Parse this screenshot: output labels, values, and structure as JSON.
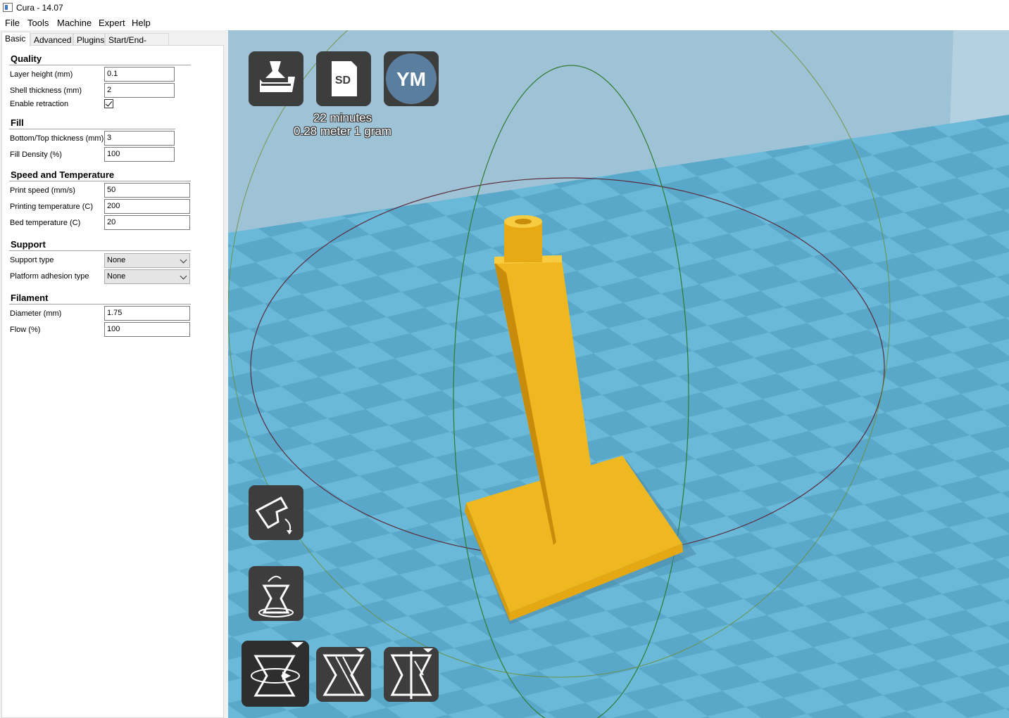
{
  "window": {
    "title": "Cura - 14.07"
  },
  "menu": [
    "File",
    "Tools",
    "Machine",
    "Expert",
    "Help"
  ],
  "tabs": [
    "Basic",
    "Advanced",
    "Plugins",
    "Start/End-GCode"
  ],
  "active_tab": "Basic",
  "sections": {
    "quality": {
      "title": "Quality",
      "layer_height": {
        "label": "Layer height (mm)",
        "value": "0.1"
      },
      "shell_thickness": {
        "label": "Shell thickness (mm)",
        "value": "2"
      },
      "enable_retraction": {
        "label": "Enable retraction",
        "checked": true
      }
    },
    "fill": {
      "title": "Fill",
      "bottom_top": {
        "label": "Bottom/Top thickness (mm)",
        "value": "3"
      },
      "fill_density": {
        "label": "Fill Density (%)",
        "value": "100"
      }
    },
    "speed": {
      "title": "Speed and Temperature",
      "print_speed": {
        "label": "Print speed (mm/s)",
        "value": "50"
      },
      "print_temp": {
        "label": "Printing temperature (C)",
        "value": "200"
      },
      "bed_temp": {
        "label": "Bed temperature (C)",
        "value": "20"
      }
    },
    "support": {
      "title": "Support",
      "support_type": {
        "label": "Support type",
        "value": "None"
      },
      "adhesion": {
        "label": "Platform adhesion type",
        "value": "None"
      }
    },
    "filament": {
      "title": "Filament",
      "diameter": {
        "label": "Diameter (mm)",
        "value": "1.75"
      },
      "flow": {
        "label": "Flow (%)",
        "value": "100"
      }
    }
  },
  "viewport": {
    "top_buttons": {
      "load": "load-model",
      "sd": "SD",
      "ym": "YM"
    },
    "estimate": {
      "time": "22 minutes",
      "material": "0.28 meter 1 gram"
    },
    "colors": {
      "floor_light": "#6ab9d9",
      "floor_dark": "#5aa8c9",
      "wall": "#9fc3d6",
      "model": "#f0b820",
      "button": "#3d3d3d"
    }
  }
}
